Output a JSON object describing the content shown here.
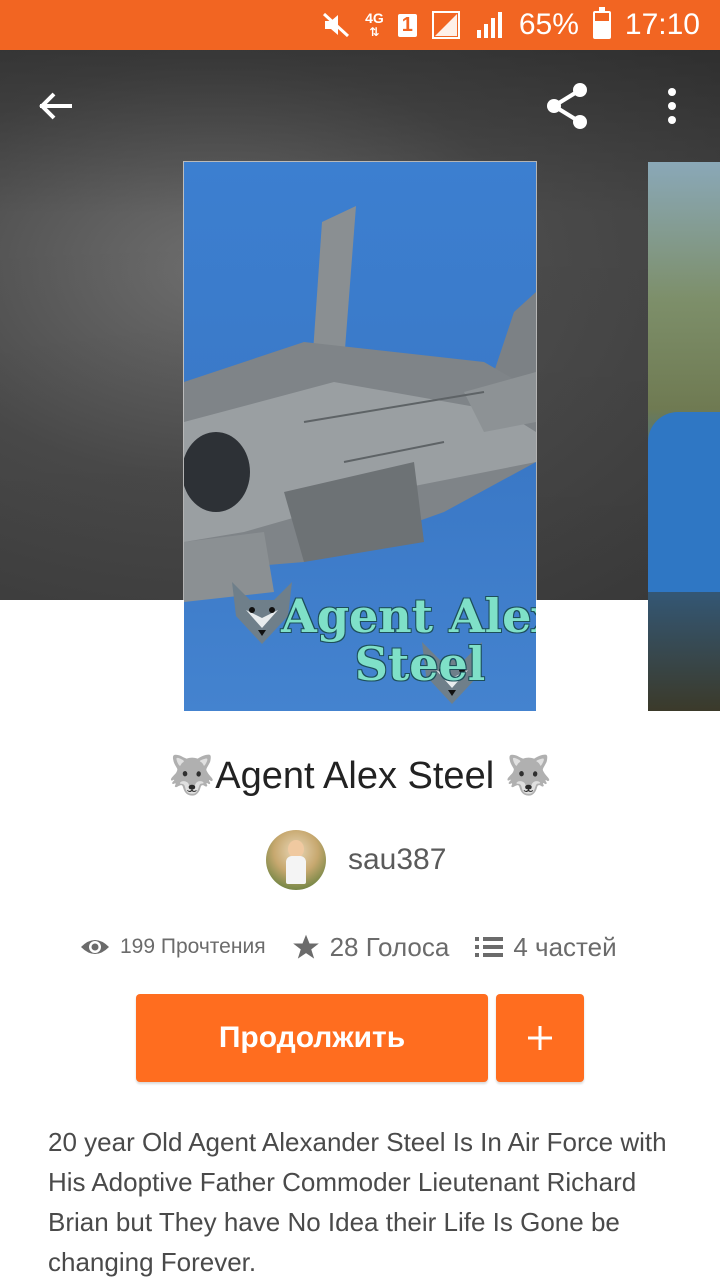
{
  "status_bar": {
    "network": "4G",
    "sim": "1",
    "battery": "65%",
    "battery_level": 0.65,
    "time": "17:10",
    "icons": [
      "mute-icon",
      "4g-icon",
      "sim-icon",
      "signal-icon",
      "signal-icon",
      "battery-icon"
    ]
  },
  "toolbar": {
    "back_icon": "arrow-left-icon",
    "share_icon": "share-icon",
    "more_icon": "more-vertical-icon"
  },
  "cover": {
    "title_text": "Agent Alex\nSteel"
  },
  "story": {
    "title": "🐺Agent Alex Steel 🐺",
    "author": "sau387",
    "reads": "199 Прочтения",
    "votes": "28 Голоса",
    "parts": "4 частей",
    "continue_label": "Продолжить",
    "add_label": "+",
    "description": "20 year Old Agent Alexander Steel Is In Air Force with His Adoptive Father Commoder Lieutenant Richard Brian but They have No Idea their Life Is Gone be changing Forever."
  },
  "colors": {
    "accent": "#ff6d1f",
    "status_bar": "#f26522"
  }
}
